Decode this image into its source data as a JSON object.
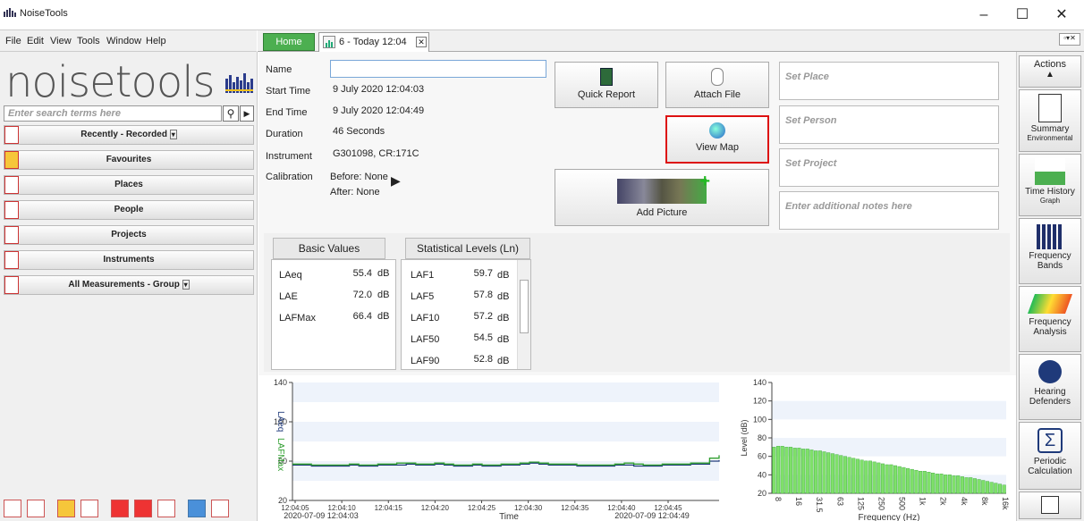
{
  "window": {
    "title": "NoiseTools"
  },
  "menu": [
    "File",
    "Edit",
    "View",
    "Tools",
    "Window",
    "Help"
  ],
  "tabs": {
    "home": "Home",
    "measurement": "6 - Today 12:04"
  },
  "sidebar": {
    "logo_text": "noisetools",
    "search_placeholder": "Enter search terms here",
    "items": [
      {
        "label": "Recently - Recorded"
      },
      {
        "label": "Favourites"
      },
      {
        "label": "Places"
      },
      {
        "label": "People"
      },
      {
        "label": "Projects"
      },
      {
        "label": "Instruments"
      },
      {
        "label": "All Measurements - Group"
      }
    ]
  },
  "details": {
    "name_label": "Name",
    "name_value": "",
    "start_label": "Start Time",
    "start_value": "9 July 2020 12:04:03",
    "end_label": "End Time",
    "end_value": "9 July 2020 12:04:49",
    "duration_label": "Duration",
    "duration_value": "46 Seconds",
    "instrument_label": "Instrument",
    "instrument_value": "G301098, CR:171C",
    "calibration_label": "Calibration",
    "calibration_before": "Before: None",
    "calibration_after": "After: None"
  },
  "actions": {
    "quick_report": "Quick Report",
    "attach_file": "Attach File",
    "view_map": "View Map",
    "add_picture": "Add Picture"
  },
  "fields": {
    "place": "Set Place",
    "person": "Set Person",
    "project": "Set Project",
    "notes": "Enter additional notes here"
  },
  "basic_values": {
    "title": "Basic Values",
    "rows": [
      {
        "name": "LAeq",
        "value": "55.4",
        "unit": "dB"
      },
      {
        "name": "LAE",
        "value": "72.0",
        "unit": "dB"
      },
      {
        "name": "LAFMax",
        "value": "66.4",
        "unit": "dB"
      }
    ]
  },
  "statistical_levels": {
    "title": "Statistical Levels (Ln)",
    "rows": [
      {
        "name": "LAF1",
        "value": "59.7",
        "unit": "dB"
      },
      {
        "name": "LAF5",
        "value": "57.8",
        "unit": "dB"
      },
      {
        "name": "LAF10",
        "value": "57.2",
        "unit": "dB"
      },
      {
        "name": "LAF50",
        "value": "54.5",
        "unit": "dB"
      },
      {
        "name": "LAF90",
        "value": "52.8",
        "unit": "dB"
      }
    ]
  },
  "right_panel": {
    "actions_label": "Actions",
    "items": [
      {
        "label": "Summary",
        "sub": "Environmental"
      },
      {
        "label": "Time History",
        "sub": "Graph"
      },
      {
        "label": "Frequency",
        "sub": "Bands"
      },
      {
        "label": "Frequency",
        "sub": "Analysis"
      },
      {
        "label": "Hearing",
        "sub": "Defenders"
      },
      {
        "label": "Periodic",
        "sub": "Calculation"
      }
    ]
  },
  "chart_data": [
    {
      "type": "line",
      "ylabel_series": [
        "LAeq",
        "LAFMax"
      ],
      "colors": {
        "LAeq": "#1f3a7a",
        "LAFMax": "#2e9e2e"
      },
      "xlabel": "Time",
      "ylim": [
        20,
        140
      ],
      "yticks": [
        20,
        60,
        100,
        140
      ],
      "x_ticks": [
        "12:04:05",
        "12:04:10",
        "12:04:15",
        "12:04:20",
        "12:04:25",
        "12:04:30",
        "12:04:35",
        "12:04:40",
        "12:04:45"
      ],
      "x_start": "2020-07-09 12:04:03",
      "x_end": "2020-07-09 12:04:49",
      "series": [
        {
          "name": "LAeq",
          "values": [
            56,
            56,
            55,
            55,
            55,
            55,
            56,
            55,
            55,
            56,
            56,
            56,
            57,
            56,
            56,
            57,
            56,
            55,
            55,
            56,
            55,
            55,
            56,
            56,
            57,
            58,
            57,
            56,
            56,
            56,
            55,
            55,
            55,
            55,
            56,
            56,
            55,
            55,
            55,
            56,
            56,
            56,
            57,
            57,
            60,
            61
          ]
        },
        {
          "name": "LAFMax",
          "values": [
            57,
            57,
            56,
            56,
            56,
            56,
            57,
            56,
            56,
            57,
            57,
            58,
            58,
            57,
            57,
            58,
            57,
            56,
            56,
            57,
            56,
            56,
            57,
            57,
            58,
            59,
            58,
            57,
            57,
            57,
            56,
            56,
            56,
            56,
            57,
            58,
            57,
            56,
            56,
            57,
            57,
            57,
            58,
            58,
            63,
            66
          ]
        }
      ]
    },
    {
      "type": "bar",
      "ylabel": "Level (dB)",
      "xlabel": "Frequency (Hz)",
      "ylim": [
        20,
        140
      ],
      "yticks": [
        20,
        40,
        60,
        80,
        100,
        120,
        140
      ],
      "x_tick_labels": [
        "8",
        "16",
        "31.5",
        "63",
        "125",
        "250",
        "500",
        "1k",
        "2k",
        "4k",
        "8k",
        "16k"
      ],
      "bar_color": "#7fe06a",
      "values": [
        70,
        71,
        71,
        70,
        70,
        69,
        69,
        68,
        68,
        67,
        66,
        66,
        65,
        64,
        63,
        62,
        61,
        60,
        59,
        58,
        57,
        56,
        55,
        55,
        54,
        53,
        52,
        51,
        51,
        50,
        49,
        48,
        47,
        46,
        45,
        44,
        44,
        43,
        42,
        41,
        41,
        40,
        40,
        39,
        39,
        38,
        37,
        37,
        36,
        35,
        34,
        33,
        32,
        31,
        30,
        29
      ]
    }
  ]
}
